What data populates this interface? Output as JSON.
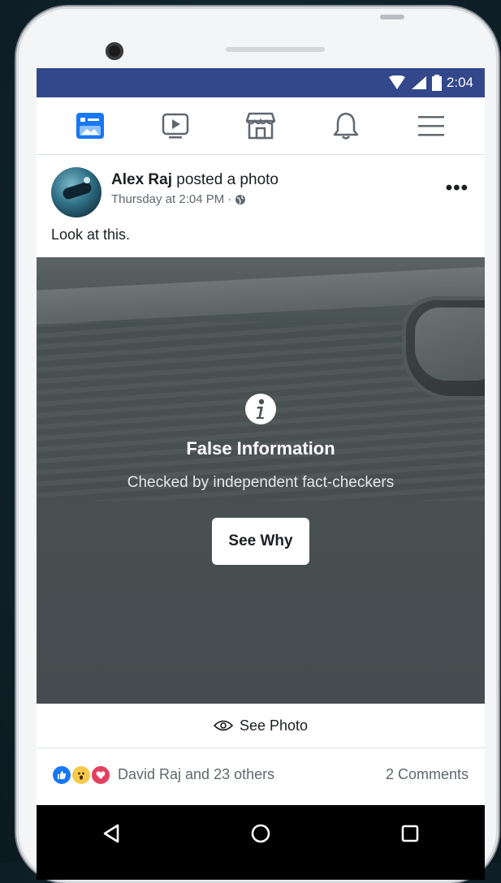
{
  "status_bar": {
    "time": "2:04"
  },
  "nav": {
    "items": [
      "news-feed",
      "watch",
      "marketplace",
      "notifications",
      "menu"
    ],
    "active": "news-feed",
    "accent": "#1877f2"
  },
  "post": {
    "author": "Alex Raj",
    "action": "posted a photo",
    "timestamp": "Thursday at 2:04 PM",
    "separator": "·",
    "text": "Look at this.",
    "more": "•••"
  },
  "fact_check": {
    "title": "False Information",
    "subtitle": "Checked by independent fact-checkers",
    "button": "See Why"
  },
  "see_photo": {
    "label": "See Photo"
  },
  "engagement": {
    "reactions_text": "David Raj and 23 others",
    "comments": "2 Comments",
    "reaction_types": [
      "like",
      "wow",
      "love"
    ]
  },
  "colors": {
    "status_bar": "#33488a",
    "like": "#1877f2",
    "love": "#e4405f",
    "wow": "#f7c94b"
  }
}
